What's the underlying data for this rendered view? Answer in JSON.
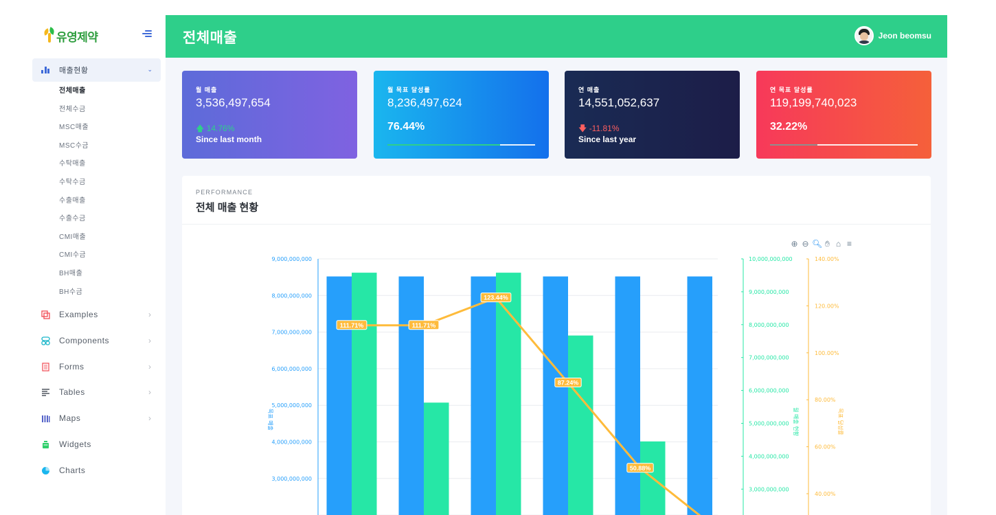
{
  "brand": {
    "name": "유영제약"
  },
  "sidebar": {
    "active_group": "매출현황",
    "sub_items": [
      "전체매출",
      "전체수금",
      "MSC매출",
      "MSC수금",
      "수탁매출",
      "수탁수금",
      "수출매출",
      "수출수금",
      "CMI매출",
      "CMI수금",
      "BH매출",
      "BH수금"
    ],
    "current_sub": "전체매출",
    "items": [
      {
        "label": "Examples",
        "icon": "copy-icon",
        "color": "#f2565d"
      },
      {
        "label": "Components",
        "icon": "components-icon",
        "color": "#1ab6c9"
      },
      {
        "label": "Forms",
        "icon": "forms-icon",
        "color": "#f2565d"
      },
      {
        "label": "Tables",
        "icon": "tables-icon",
        "color": "#323a45"
      },
      {
        "label": "Maps",
        "icon": "maps-icon",
        "color": "#5463c8"
      },
      {
        "label": "Widgets",
        "icon": "widgets-icon",
        "color": "#2ecf6a"
      },
      {
        "label": "Charts",
        "icon": "charts-icon",
        "color": "#1ab6ee"
      }
    ]
  },
  "header": {
    "title": "전체매출",
    "user_name": "Jeon beomsu",
    "bg_color": "#2ecf8a"
  },
  "stats": [
    {
      "label": "월 매출",
      "value": "3,536,497,654",
      "change": "14.76%",
      "change_dir": "up",
      "since": "Since last month"
    },
    {
      "label": "월 목표 달성률",
      "value": "8,236,497,624",
      "percent": "76.44%",
      "progress": 0.7644,
      "fill_color": "#2ecf8a"
    },
    {
      "label": "연 매출",
      "value": "14,551,052,637",
      "change": "-11.81%",
      "change_dir": "down",
      "since": "Since last year"
    },
    {
      "label": "연 목표 달성률",
      "value": "119,199,740,023",
      "percent": "32.22%",
      "progress": 0.3222,
      "fill_color": "#8f8f8f"
    }
  ],
  "performance": {
    "eyebrow": "PERFORMANCE",
    "title": "전체 매출 현황"
  },
  "toolbar": [
    "zoom-in-icon",
    "zoom-out-icon",
    "zoom-select-icon",
    "pan-hand-icon",
    "home-reset-icon",
    "menu-icon"
  ],
  "chart_data": {
    "type": "bar",
    "series": [
      {
        "name": "목표 매출",
        "type": "bar",
        "color": "#269ffb",
        "axis": "left",
        "values": [
          8520000000,
          8520000000,
          8520000000,
          8520000000,
          8520000000,
          8520000000
        ]
      },
      {
        "name": "월 매출 현황",
        "type": "bar",
        "color": "#26e7a6",
        "axis": "right1",
        "values": [
          9580000000,
          5630000000,
          9580000000,
          7670000000,
          4450000000,
          null
        ]
      },
      {
        "name": "목표 달성률",
        "type": "line",
        "color": "#febb3b",
        "axis": "right2",
        "values": [
          111.71,
          111.71,
          123.44,
          87.24,
          50.88,
          26.5
        ],
        "labels": [
          "111.71%",
          "111.71%",
          "123.44%",
          "87.24%",
          "50.88%",
          ""
        ]
      }
    ],
    "axes": {
      "left": {
        "label": "목표 매출",
        "ylim": [
          2000000000,
          9000000000
        ],
        "ticks": [
          "9,000,000,000",
          "8,000,000,000",
          "7,000,000,000",
          "6,000,000,000",
          "5,000,000,000",
          "4,000,000,000",
          "3,000,000,000"
        ],
        "color": "#269ffb"
      },
      "right1": {
        "label": "월 매출 현황",
        "ylim": [
          2000000000,
          10000000000
        ],
        "ticks": [
          "10,000,000,000",
          "9,000,000,000",
          "8,000,000,000",
          "7,000,000,000",
          "6,000,000,000",
          "5,000,000,000",
          "4,000,000,000",
          "3,000,000,000"
        ],
        "color": "#26e7a6"
      },
      "right2": {
        "label": "목표 달성률",
        "ylim": [
          20,
          140
        ],
        "ticks": [
          "140.00%",
          "120.00%",
          "100.00%",
          "80.00%",
          "60.00%",
          "40.00%"
        ],
        "color": "#febb3b"
      }
    },
    "grid": true
  }
}
